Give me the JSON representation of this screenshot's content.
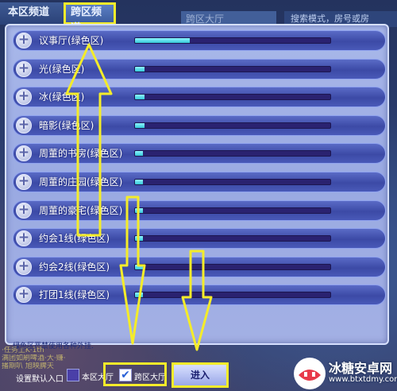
{
  "tabs": {
    "local": "本区频道",
    "cross": "跨区频道"
  },
  "background": {
    "room_title": "跨区大厅",
    "search_text": "搜索模式，房号或房",
    "chat_lines": [
      "·任务上K·1th",
      "满团如刷啤酒·大·赚·",
      "播期叭  旭映脾天"
    ]
  },
  "rooms": [
    {
      "name": "议事厅(绿色区)",
      "load": 0.28
    },
    {
      "name": "光(绿色区)",
      "load": 0.05
    },
    {
      "name": "冰(绿色区)",
      "load": 0.05
    },
    {
      "name": "暗影(绿色区)",
      "load": 0.05
    },
    {
      "name": "周董的书房(绿色区)",
      "load": 0.04
    },
    {
      "name": "周董的庄园(绿色区)",
      "load": 0.04
    },
    {
      "name": "周董的豪宅(绿色区)",
      "load": 0.04
    },
    {
      "name": "约会1线(绿色区)",
      "load": 0.04
    },
    {
      "name": "约会2线(绿色区)",
      "load": 0.04
    },
    {
      "name": "打团1线(绿色区)",
      "load": 0.04
    }
  ],
  "notice": "绿色区严禁使用各种外挂.",
  "bottom": {
    "default_label": "设置默认入口",
    "local_option": "本区大厅",
    "cross_option": "跨区大厅",
    "enter_button": "进入",
    "check_glyph": "✔"
  },
  "watermark": {
    "name": "冰糖安卓网",
    "url": "www.btxtdmy.com"
  },
  "colors": {
    "highlight": "#f4ec2a",
    "bar_fill": "#34c8d8",
    "bar_track": "#2a2270",
    "panel": "#a3b0e4",
    "row": "#3c4aa6"
  },
  "icons": {
    "row_add": "plus-circle-icon"
  }
}
